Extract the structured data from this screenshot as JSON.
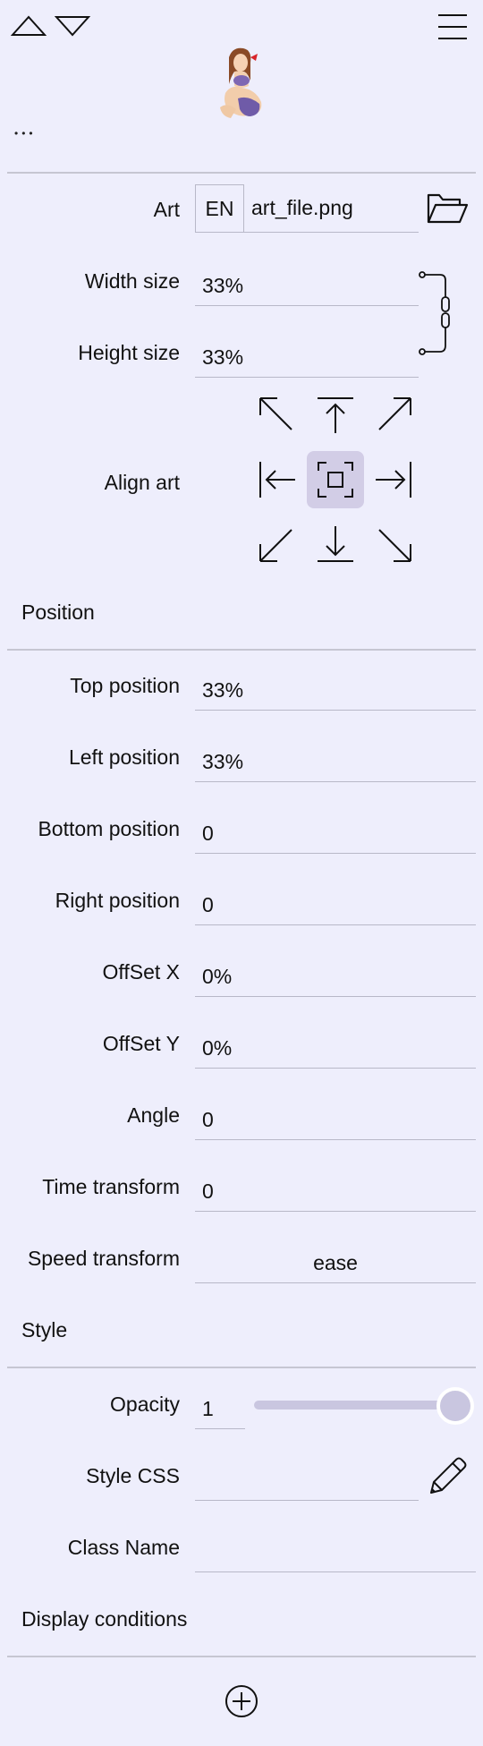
{
  "toolbar": {
    "dots": "•••"
  },
  "art": {
    "label": "Art",
    "lang": "EN",
    "file": "art_file.png"
  },
  "size": {
    "width_label": "Width size",
    "width_value": "33%",
    "height_label": "Height size",
    "height_value": "33%"
  },
  "align": {
    "label": "Align art"
  },
  "position": {
    "header": "Position",
    "fields": [
      {
        "label": "Top position",
        "value": "33%"
      },
      {
        "label": "Left position",
        "value": "33%"
      },
      {
        "label": "Bottom position",
        "value": "0"
      },
      {
        "label": "Right position",
        "value": "0"
      },
      {
        "label": "OffSet X",
        "value": "0%"
      },
      {
        "label": "OffSet Y",
        "value": "0%"
      },
      {
        "label": "Angle",
        "value": "0"
      },
      {
        "label": "Time transform",
        "value": "0"
      }
    ],
    "speed_label": "Speed transform",
    "speed_value": "ease"
  },
  "style": {
    "header": "Style",
    "opacity_label": "Opacity",
    "opacity_value": "1",
    "opacity_slider": 1.0,
    "css_label": "Style CSS",
    "css_value": "",
    "class_label": "Class Name",
    "class_value": ""
  },
  "display": {
    "header": "Display conditions"
  },
  "colors": {
    "background": "#eeeefc",
    "accent": "#d2cde6",
    "slider_track": "#c9c6e0"
  }
}
